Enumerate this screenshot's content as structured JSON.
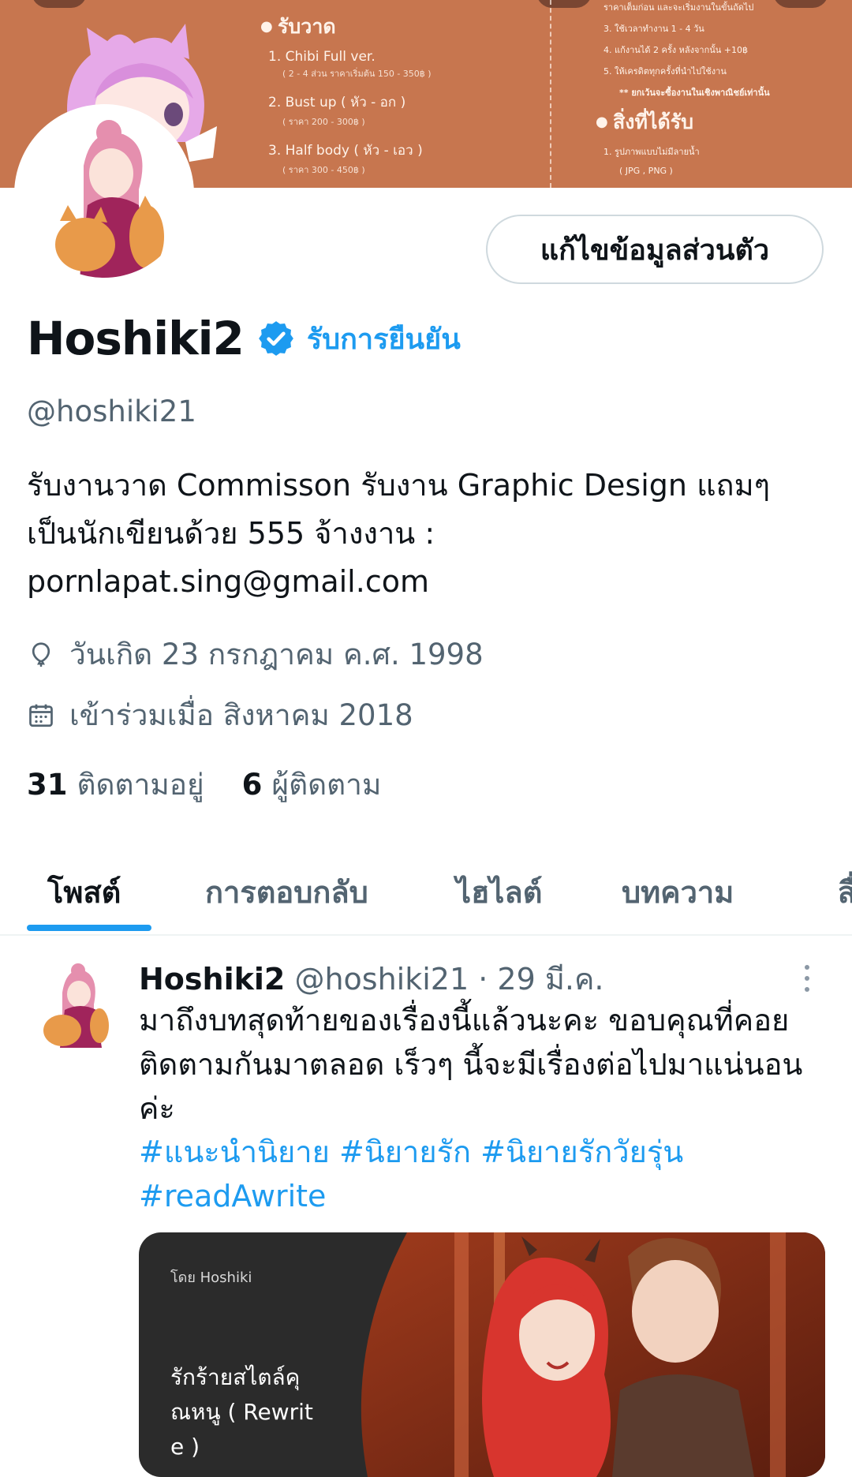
{
  "banner": {
    "section1_title": "รับวาด",
    "items": [
      {
        "label": "1. Chibi Full ver.",
        "price": "( 2 - 4 ส่วน ราคาเริ่มต้น 150 - 350฿ )"
      },
      {
        "label": "2. Bust up ( หัว - อก )",
        "price": "( ราคา 200 - 300฿ )"
      },
      {
        "label": "3. Half body ( หัว - เอว )",
        "price": "( ราคา 300 - 450฿ )"
      }
    ],
    "rules": [
      "ราคาเต็มก่อน และจะเริ่มงานในขั้นถัดไป",
      "3. ใช้เวลาทำงาน 1 - 4 วัน",
      "4. แก้งานได้ 2 ครั้ง หลังจากนั้น +10฿",
      "5. ให้เครดิตทุกครั้งที่นำไปใช้งาน",
      "** ยกเว้นจะซื้องานในเชิงพาณิชย์เท่านั้น"
    ],
    "section2_title": "สิ่งที่ได้รับ",
    "receive": [
      "1. รูปภาพแบบไม่มีลายน้ำ",
      "( JPG , PNG )"
    ]
  },
  "profile": {
    "edit_button": "แก้ไขข้อมูลส่วนตัว",
    "name": "Hoshiki2",
    "verify_link": "รับการยืนยัน",
    "handle": "@hoshiki21",
    "bio": "รับงานวาด Commisson รับงาน Graphic Design แถมๆ เป็นนักเขียนด้วย 555  จ้างงาน : pornlapat.sing@gmail.com",
    "birthday": "วันเกิด 23 กรกฎาคม ค.ศ. 1998",
    "joined": "เข้าร่วมเมื่อ สิงหาคม 2018",
    "following_count": "31",
    "following_label": "ติดตามอยู่",
    "followers_count": "6",
    "followers_label": "ผู้ติดตาม"
  },
  "tabs": [
    "โพสต์",
    "การตอบกลับ",
    "ไฮไลต์",
    "บทความ",
    "สื่อ"
  ],
  "post": {
    "name": "Hoshiki2",
    "handle": "@hoshiki21",
    "separator": "·",
    "date": "29 มี.ค.",
    "text": "มาถึงบทสุดท้ายของเรื่องนี้แล้วนะคะ ขอบคุณที่คอยติดตามกันมาตลอด เร็วๆ นี้จะมีเรื่องต่อไปมาแน่นอนค่ะ",
    "hashtags": "#แนะนำนิยาย #นิยายรัก #นิยายรักวัยรุ่น #readAwrite",
    "card": {
      "by": "โดย  Hoshiki",
      "title": "รักร้ายสไตล์คุณหนู ( Rewrite )"
    }
  },
  "colors": {
    "accent": "#1d9bf0",
    "banner": "#c7764f",
    "secondary_text": "#536471"
  }
}
